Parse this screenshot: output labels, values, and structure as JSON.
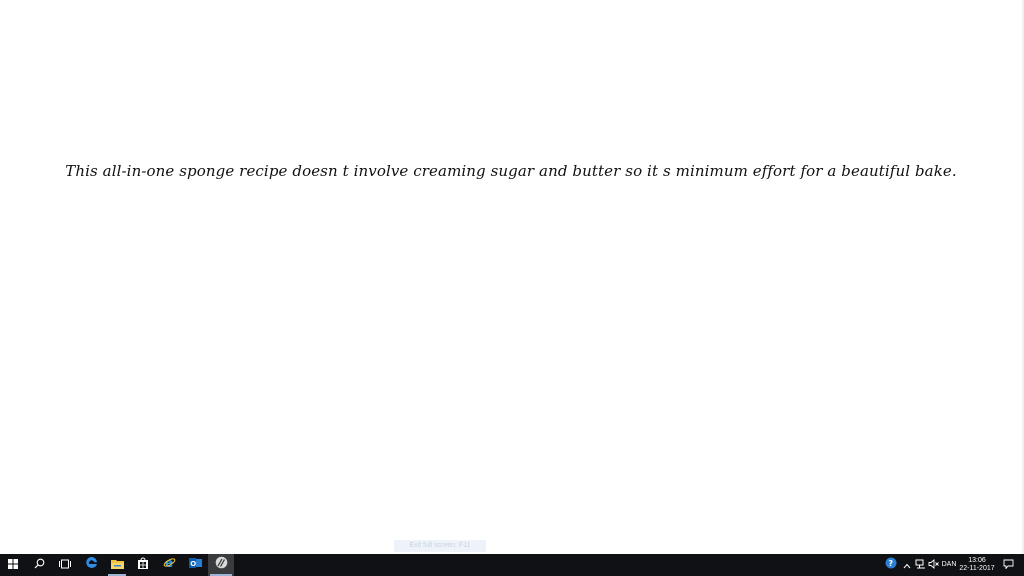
{
  "document": {
    "text": "This all-in-one sponge recipe doesn t involve creaming sugar and butter so it s minimum effort for a beautiful bake.",
    "fullscreen_hint": "Exit full screen: F11"
  },
  "taskbar": {
    "language": "DAN",
    "time": "13:06",
    "date": "22-11-2017",
    "icons": [
      "windows-start-icon",
      "search-icon",
      "task-view-icon",
      "edge-icon",
      "file-explorer-icon",
      "store-icon",
      "internet-explorer-icon",
      "outlook-icon",
      "active-app-icon"
    ]
  },
  "colors": {
    "taskbar_bg": "#101114",
    "accent_blue": "#0078d7",
    "help_blue": "#2a7fd4"
  }
}
